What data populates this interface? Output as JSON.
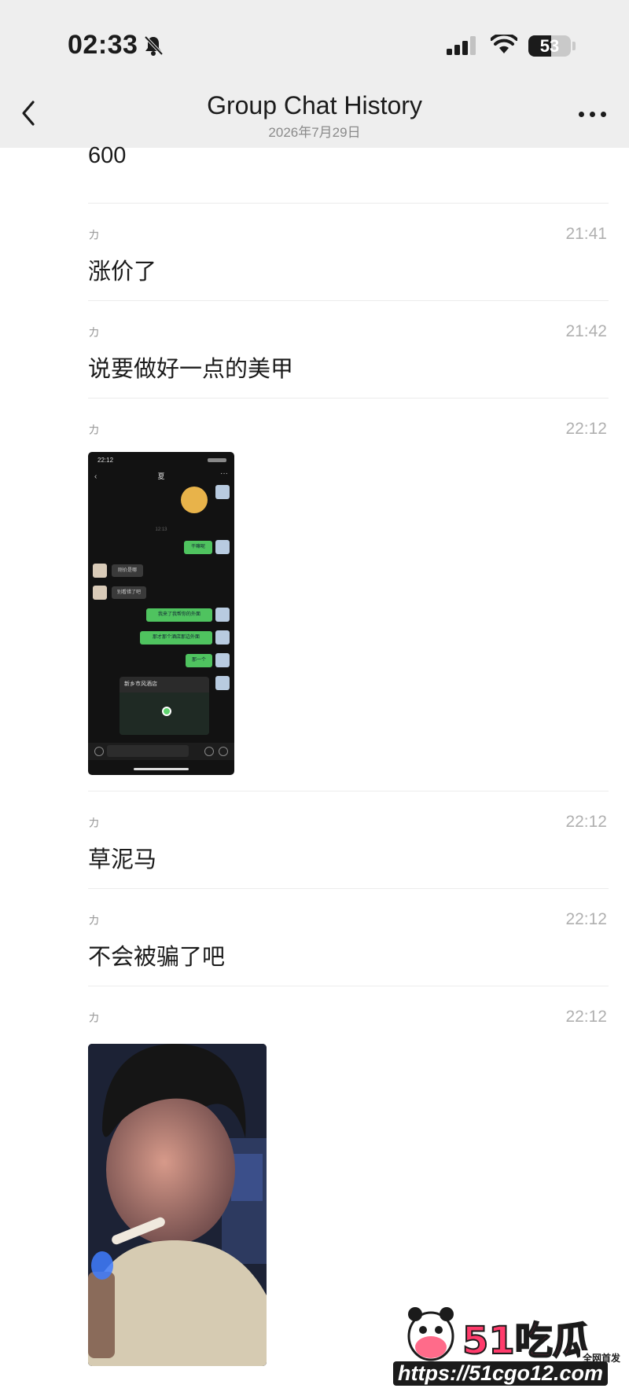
{
  "status_bar": {
    "time": "02:33",
    "battery": "53",
    "icons": [
      "bell-slash-icon",
      "cellular-signal-icon",
      "wifi-icon",
      "battery-icon"
    ]
  },
  "nav": {
    "title": "Group Chat History",
    "subtitle": "2026年7月29日",
    "icons": [
      "chevron-left-icon",
      "ellipsis-icon"
    ]
  },
  "messages": [
    {
      "sender": "",
      "time": "",
      "text": "600"
    },
    {
      "sender": "カ",
      "time": "21:41",
      "text": "涨价了"
    },
    {
      "sender": "カ",
      "time": "21:42",
      "text": "说要做好一点的美甲"
    },
    {
      "sender": "カ",
      "time": "22:12",
      "image": "chat-screenshot"
    },
    {
      "sender": "カ",
      "time": "22:12",
      "text": "草泥马"
    },
    {
      "sender": "カ",
      "time": "22:12",
      "text": "不会被骗了吧"
    },
    {
      "sender": "カ",
      "time": "22:12",
      "image": "selfie-photo"
    }
  ],
  "embedded_screenshot": {
    "time": "22:12",
    "contact": "夏",
    "center_time": "12:13",
    "bubbles": [
      {
        "side": "right",
        "text": "干嘛呢"
      },
      {
        "side": "left",
        "text": "刚价是哪"
      },
      {
        "side": "left",
        "text": "别看错了吧"
      },
      {
        "side": "right",
        "text": "我来了我帮你的外面"
      },
      {
        "side": "right",
        "text": "那才那个酒店那边外面"
      },
      {
        "side": "right",
        "text": "那一个"
      }
    ],
    "location_title": "新乡市风酒店"
  },
  "watermark": {
    "brand": "51吃瓜",
    "tag": "全网首发",
    "url": "https://51cgo12.com"
  },
  "colors": {
    "bar_bg": "#eeeeee",
    "text": "#1b1b1b",
    "muted": "#b0b0b0",
    "bubble_green": "#4fc35f",
    "watermark_red": "#ff3b6b"
  }
}
